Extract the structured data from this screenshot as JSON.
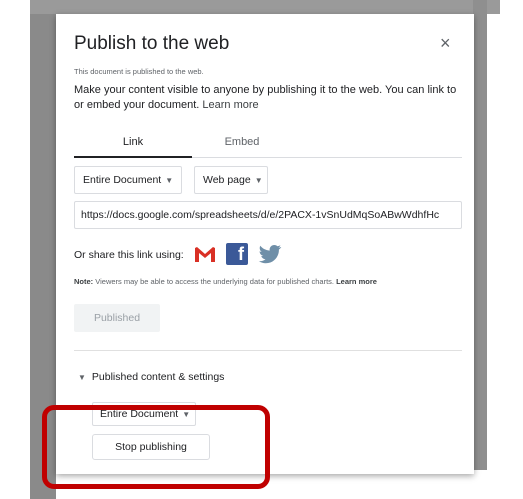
{
  "dialog": {
    "title": "Publish to the web",
    "close_glyph": "×",
    "status_note": "This document is published to the web.",
    "description": "Make your content visible to anyone by publishing it to the web. You can link to or embed your document. ",
    "learn_more": "Learn more",
    "tabs": [
      {
        "label": "Link",
        "active": true
      },
      {
        "label": "Embed",
        "active": false
      }
    ],
    "document_select": "Entire Document",
    "format_select": "Web page",
    "url": "https://docs.google.com/spreadsheets/d/e/2PACX-1vSnUdMqSoABwWdhfHc",
    "share_label": "Or share this link using:",
    "share_icons": [
      "gmail-icon",
      "facebook-icon",
      "twitter-icon"
    ],
    "note_prefix": "Note:",
    "note_text": " Viewers may be able to access the underlying data for published charts. ",
    "note_learn_more": "Learn more",
    "published_button": "Published",
    "settings_toggle": "Published content & settings",
    "settings_select": "Entire Document",
    "stop_button": "Stop publishing"
  },
  "colors": {
    "highlight": "#c00000",
    "facebook": "#3b5998",
    "gmail_red": "#d93025",
    "twitter": "#6f8fa8"
  }
}
